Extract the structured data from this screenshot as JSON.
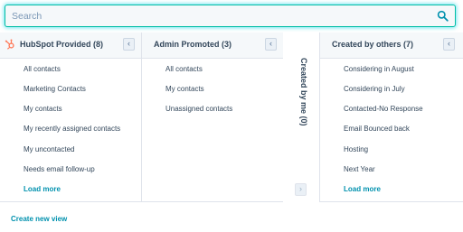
{
  "search": {
    "placeholder": "Search",
    "value": ""
  },
  "columns": [
    {
      "title": "HubSpot Provided (8)",
      "collapse_glyph": "‹",
      "items": [
        "All contacts",
        "Marketing Contacts",
        "My contacts",
        "My recently assigned contacts",
        "My uncontacted",
        "Needs email follow-up"
      ],
      "load_more": "Load more"
    },
    {
      "title": "Admin Promoted (3)",
      "collapse_glyph": "‹",
      "items": [
        "All contacts",
        "My contacts",
        "Unassigned contacts"
      ]
    },
    {
      "title": "Created by me (0)",
      "collapsed": true,
      "expand_glyph": "›"
    },
    {
      "title": "Created by others (7)",
      "collapse_glyph": "‹",
      "items": [
        "Considering in August",
        "Considering in July",
        "Contacted-No Response",
        "Email Bounced back",
        "Hosting",
        "Next Year"
      ],
      "load_more": "Load more"
    }
  ],
  "footer": {
    "create_new_view": "Create new view"
  },
  "colors": {
    "accent_teal": "#00bda5",
    "link": "#0091ae",
    "text": "#33475b",
    "hubspot_orange": "#ff7a59"
  },
  "icons": {
    "search": "search-icon",
    "hubspot": "hubspot-sprocket-icon"
  }
}
